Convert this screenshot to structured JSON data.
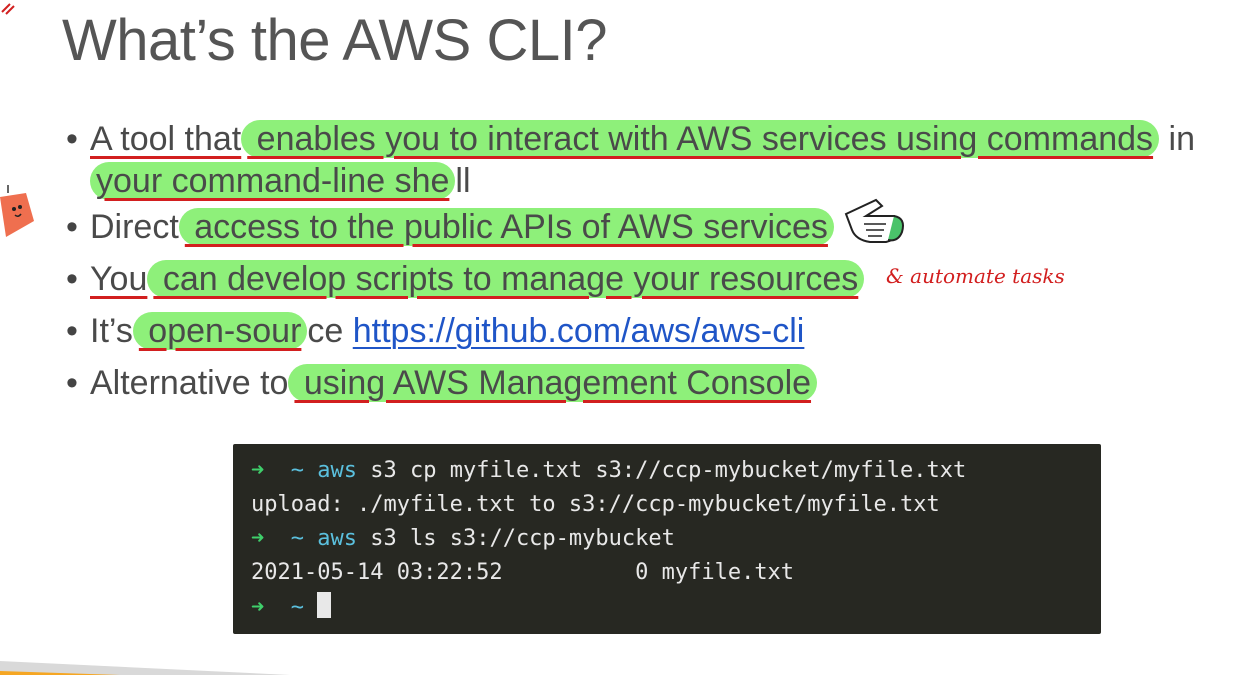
{
  "title": "What’s the AWS CLI?",
  "bullets": [
    {
      "pre": "A tool that",
      "hl": " enables you to interact with AWS services using commands",
      "post": " in",
      "line2_hl": "your command-line she",
      "line2_post": "ll"
    },
    {
      "pre": "Direct",
      "hl": " access to the public APIs of AWS services ",
      "post": ""
    },
    {
      "pre": "You",
      "hl": " can develop scripts to manage your resources ",
      "post": ""
    },
    {
      "pre": "It’s",
      "hl": " open-sour",
      "post": "ce ",
      "link": "https://github.com/aws/aws-cli"
    },
    {
      "pre": "Alternative to",
      "hl": " using AWS Management Console",
      "post": ""
    }
  ],
  "annotation": "& automate tasks",
  "terminal": {
    "prompt_arrow": "➜",
    "prompt_tilde": "~",
    "line1_cmd": "aws",
    "line1_rest": " s3 cp myfile.txt s3://ccp-mybucket/myfile.txt",
    "line2": "upload: ./myfile.txt to s3://ccp-mybucket/myfile.txt",
    "line3_cmd": "aws",
    "line3_rest": " s3 ls s3://ccp-mybucket",
    "line4": "2021-05-14 03:22:52          0 myfile.txt"
  }
}
